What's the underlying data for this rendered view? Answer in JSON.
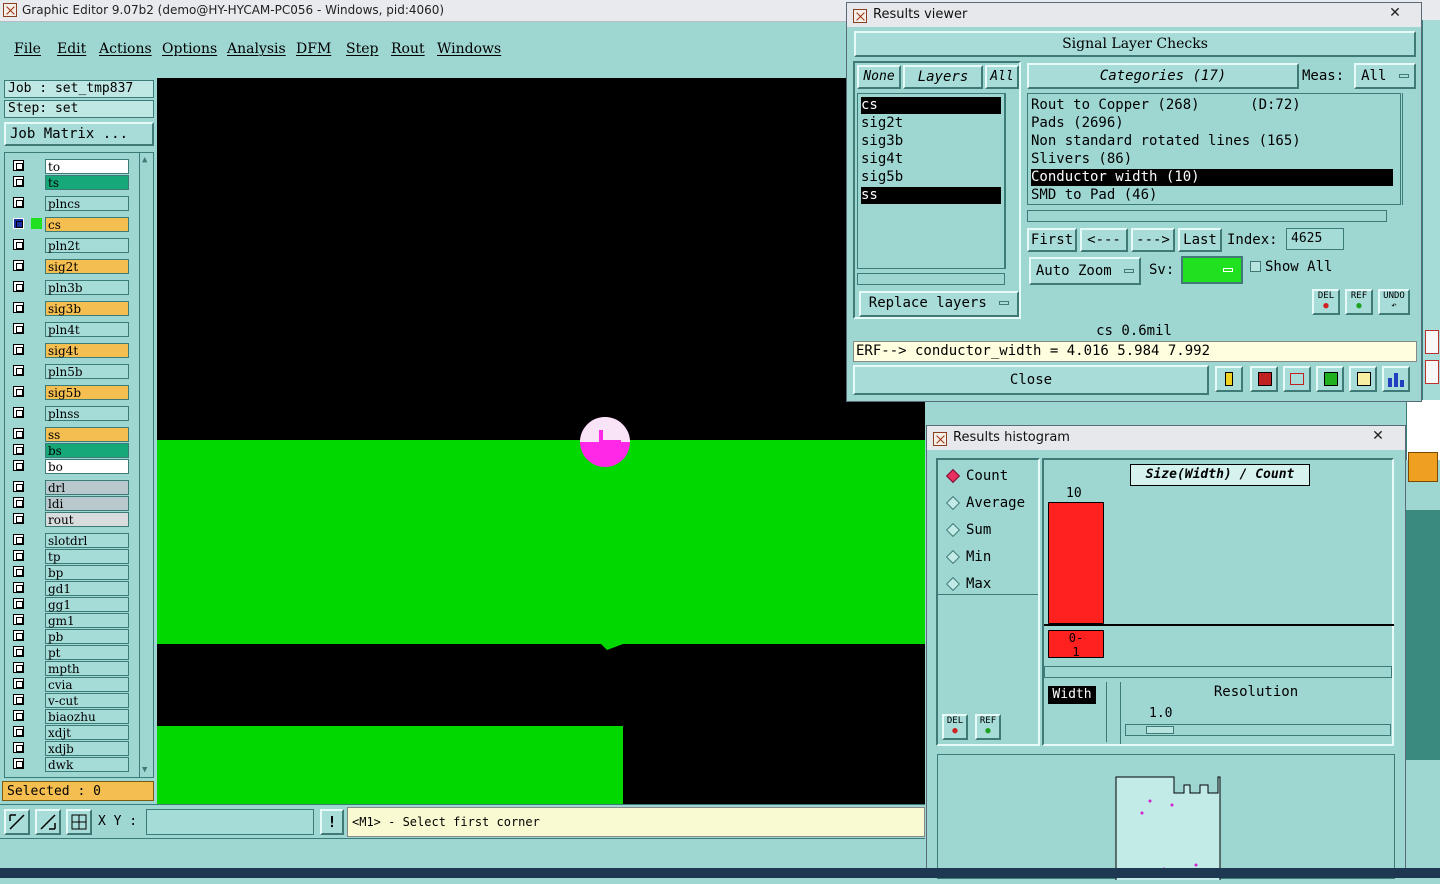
{
  "window": {
    "title": "Graphic Editor 9.07b2 (demo@HY-HYCAM-PC056 - Windows, pid:4060)"
  },
  "menu": [
    "File",
    "Edit",
    "Actions",
    "Options",
    "Analysis",
    "DFM",
    "Step",
    "Rout",
    "Windows"
  ],
  "job_info": {
    "job": "Job : set_tmp837",
    "step": "Step: set",
    "matrix_button": "Job Matrix ..."
  },
  "layers": [
    {
      "name": "to",
      "color": "#ffffff"
    },
    {
      "name": "ts",
      "color": "#16a878"
    },
    {
      "name": "plncs",
      "color": "#a6dcd8"
    },
    {
      "name": "cs",
      "color": "#f5be50"
    },
    {
      "name": "pln2t",
      "color": "#a6dcd8"
    },
    {
      "name": "sig2t",
      "color": "#f5be50"
    },
    {
      "name": "pln3b",
      "color": "#a6dcd8"
    },
    {
      "name": "sig3b",
      "color": "#f5be50"
    },
    {
      "name": "pln4t",
      "color": "#a6dcd8"
    },
    {
      "name": "sig4t",
      "color": "#f5be50"
    },
    {
      "name": "pln5b",
      "color": "#a6dcd8"
    },
    {
      "name": "sig5b",
      "color": "#f5be50"
    },
    {
      "name": "plnss",
      "color": "#a6dcd8"
    },
    {
      "name": "ss",
      "color": "#f5be50"
    },
    {
      "name": "bs",
      "color": "#16a878"
    },
    {
      "name": "bo",
      "color": "#ffffff"
    },
    {
      "name": "drl",
      "color": "#b8c8cc"
    },
    {
      "name": "ldi",
      "color": "#b8c8cc"
    },
    {
      "name": "rout",
      "color": "#d8dcdc"
    },
    {
      "name": "slotdrl",
      "color": "#a6dcd8"
    },
    {
      "name": "tp",
      "color": "#a6dcd8"
    },
    {
      "name": "bp",
      "color": "#a6dcd8"
    },
    {
      "name": "gd1",
      "color": "#a6dcd8"
    },
    {
      "name": "gg1",
      "color": "#a6dcd8"
    },
    {
      "name": "gm1",
      "color": "#a6dcd8"
    },
    {
      "name": "pb",
      "color": "#a6dcd8"
    },
    {
      "name": "pt",
      "color": "#a6dcd8"
    },
    {
      "name": "mpth",
      "color": "#a6dcd8"
    },
    {
      "name": "cvia",
      "color": "#a6dcd8"
    },
    {
      "name": "v-cut",
      "color": "#a6dcd8"
    },
    {
      "name": "biaozhu",
      "color": "#a6dcd8"
    },
    {
      "name": "xdjt",
      "color": "#a6dcd8"
    },
    {
      "name": "xdjb",
      "color": "#a6dcd8"
    },
    {
      "name": "dwk",
      "color": "#a6dcd8"
    }
  ],
  "selected_text": "Selected : 0",
  "bottom": {
    "xy_label": "X Y :",
    "xy_value": "",
    "prompt": "<M1> - Select first corner",
    "warn": "!"
  },
  "results_viewer": {
    "title": "Results viewer",
    "header": "Signal Layer Checks",
    "none_btn": "None",
    "layers_btn": "Layers",
    "all_btn": "All",
    "layer_list": [
      "cs",
      "sig2t",
      "sig3b",
      "sig4t",
      "sig5b",
      "ss"
    ],
    "categories_label": "Categories (17)",
    "meas_label": "Meas:",
    "meas_value": "All",
    "categories": [
      "Rout to Copper (268)      (D:72)",
      "Pads (2696)",
      "Non standard rotated lines (165)",
      "Slivers (86)",
      "Conductor width (10)",
      "SMD to Pad (46)"
    ],
    "nav": {
      "first": "First",
      "prev": "<---",
      "next": "--->",
      "last": "Last",
      "index_label": "Index:",
      "index_value": "4625"
    },
    "auto_zoom": "Auto Zoom",
    "sv_label": "Sv:",
    "show_all": "Show All",
    "replace_layers": "Replace layers",
    "del": "DEL",
    "ref": "REF",
    "undo": "UNDO",
    "layer_info": "cs 0.6mil",
    "erf_line": "ERF--> conductor_width = 4.016 5.984 7.992",
    "close": "Close"
  },
  "histogram": {
    "title": "Results histogram",
    "modes": [
      "Count",
      "Average",
      "Sum",
      "Min",
      "Max"
    ],
    "selected_mode": "Count",
    "plot_title": "Size(Width) / Count",
    "bar_value": "10",
    "bar_range": "0-\n1",
    "width_label": "Width",
    "resolution_label": "Resolution",
    "resolution_value": "1.0",
    "del": "DEL",
    "ref": "REF",
    "bar_color": "#ff2020"
  }
}
